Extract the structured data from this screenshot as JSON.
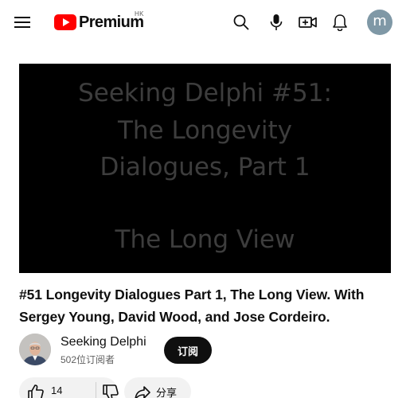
{
  "header": {
    "logo_text": "Premium",
    "region": "HK",
    "avatar_letter": "m"
  },
  "video": {
    "slide_lines": [
      "Seeking Delphi #51:",
      "The Longevity",
      "Dialogues, Part 1"
    ],
    "slide_subtitle": "The Long View",
    "title": "#51 Longevity Dialogues Part 1, The Long View. With Sergey Young, David Wood, and Jose Cordeiro."
  },
  "channel": {
    "name": "Seeking Delphi",
    "subscribers": "502位订阅者",
    "subscribe_label": "订阅"
  },
  "actions": {
    "like_count": "14",
    "share_label": "分享"
  },
  "colors": {
    "brand_red": "#ff0000",
    "avatar_bg": "#7f98a6",
    "subscribe_bg": "#0f0f0f"
  }
}
